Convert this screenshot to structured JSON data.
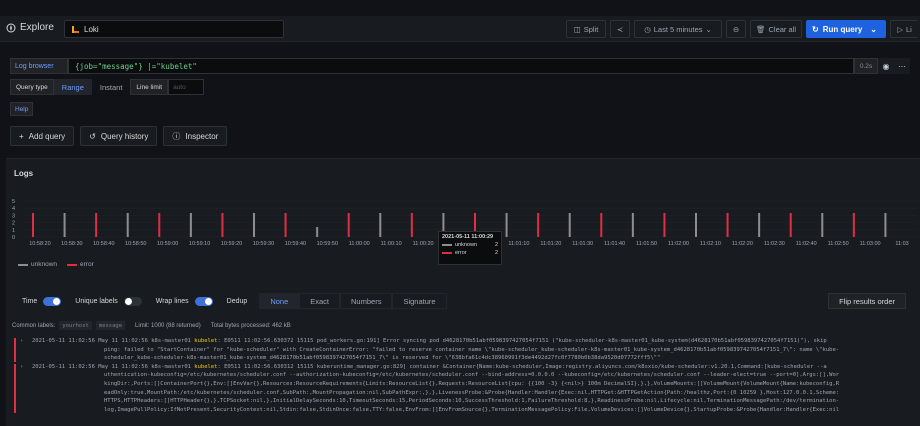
{
  "colors": {
    "unknown": "#8e8e8e",
    "error": "#e02f44",
    "accent": "#1f62e0",
    "link": "#6e9fff"
  },
  "header": {
    "title": "Explore",
    "datasource": "Loki",
    "split": "Split",
    "time_range": "Last 5 minutes",
    "clear_all": "Clear all",
    "run_query": "Run query",
    "live": "Li"
  },
  "query": {
    "log_browser": "Log browser",
    "expr": "{job=\"message\"} |=\"kubelet\"",
    "size": "0.2s",
    "query_type_label": "Query type",
    "range": "Range",
    "instant": "Instant",
    "line_limit_label": "Line limit",
    "line_limit_placeholder": "auto",
    "help": "Help"
  },
  "actions": {
    "add_query": "Add query",
    "query_history": "Query history",
    "inspector": "Inspector"
  },
  "logs": {
    "title": "Logs",
    "legend": {
      "unknown": "unknown",
      "error": "error"
    },
    "ticks": [
      "10:58:20",
      "10:58:30",
      "10:58:40",
      "10:58:50",
      "10:59:00",
      "10:59:10",
      "10:59:20",
      "10:59:30",
      "10:59:40",
      "10:59:50",
      "11:00:00",
      "11:00:10",
      "11:00:20",
      "11:00",
      "11:01:00",
      "11:01:10",
      "11:01:20",
      "11:01:30",
      "11:01:40",
      "11:01:50",
      "11:02:00",
      "11:02:10",
      "11:02:20",
      "11:02:30",
      "11:02:40",
      "11:02:50",
      "11:03:00",
      "11:03"
    ],
    "y_ticks": [
      "5",
      "4",
      "3",
      "2",
      "1",
      "0"
    ],
    "tooltip": {
      "time": "2021-05-11 11:00:29",
      "rows": [
        {
          "name": "unknown",
          "value": "2"
        },
        {
          "name": "error",
          "value": "2"
        }
      ]
    },
    "controls": {
      "time": "Time",
      "unique_labels": "Unique labels",
      "wrap_lines": "Wrap lines",
      "dedup": "Dedup",
      "dedup_options": [
        "None",
        "Exact",
        "Numbers",
        "Signature"
      ],
      "flip": "Flip results order"
    },
    "common_labels_label": "Common labels:",
    "common_labels": [
      "yourhost",
      "message"
    ],
    "limit": "Limit: 1000 (88 returned)",
    "bytes": "Total bytes processed: 462 kB",
    "entries": [
      {
        "ts": "2021-05-11 11:02:56",
        "lines": [
          {
            "pre": "May 11 11:02:56 k8s-master01 ",
            "hl": "kubelet",
            "post": ": E0511 11:02:56.630372   15115 pod_workers.go:191] Error syncing pod d4628170b51abf0598397427054f7151 (\"kube-scheduler-k8s-master01_kube-system(d4628170b51abf0598397427054f7151)\"), skip"
          },
          {
            "pre": "ping: failed to \"StartContainer\" for \"kube-scheduler\" with CreateContainerError: \"failed to reserve container name \\\"kube-scheduler_kube-scheduler-k8s-master01_kube-system_d4628170b51abf0598397427054f7151_7\\\": name \\\"kube-",
            "hl": "",
            "post": ""
          },
          {
            "pre": "scheduler_kube-scheduler-k8s-master01_kube-system_d4628170b51abf0598397427054f7151_7\\\" is reserved for \\\"638bfa61c4dc38960991f3de4492d27fc0f7780b0b38da9520d07772fff5\\\"\"",
            "hl": "",
            "post": ""
          }
        ]
      },
      {
        "ts": "2021-05-11 11:02:56",
        "lines": [
          {
            "pre": "May 11 11:02:56 k8s-master01 ",
            "hl": "kubelet",
            "post": ": E0511 11:02:56.630312   15115 kuberuntime_manager.go:829] container &Container{Name:kube-scheduler,Image:registry.aliyuncs.com/k8sxio/kube-scheduler:v1.20.1,Command:[kube-scheduler --a"
          },
          {
            "pre": "uthentication-kubeconfig=/etc/kubernetes/scheduler.conf --authorization-kubeconfig=/etc/kubernetes/scheduler.conf --bind-address=0.0.0.0 --kubeconfig=/etc/kubernetes/scheduler.conf --leader-elect=true --port=0],Args:[],Wor",
            "hl": "",
            "post": ""
          },
          {
            "pre": "kingDir:,Ports:[]ContainerPort{},Env:[]EnvVar{},Resources:ResourceRequirements{Limits:ResourceList{},Requests:ResourceList{cpu: {{100 -3} {<nil>} 100m DecimalSI},},},VolumeMounts:[]VolumeMount{VolumeMount{Name:kubeconfig,R",
            "hl": "",
            "post": ""
          },
          {
            "pre": "eadOnly:true,MountPath:/etc/kubernetes/scheduler.conf,SubPath:,MountPropagation:nil,SubPathExpr:,},},LivenessProbe:&Probe{Handler:Handler{Exec:nil,HTTPGet:&HTTPGetAction{Path:/healthz,Port:{0 10259 },Host:127.0.0.1,Scheme:",
            "hl": "",
            "post": ""
          },
          {
            "pre": "HTTPS,HTTPHeaders:[]HTTPHeader{},},TCPSocket:nil,},InitialDelaySeconds:10,TimeoutSeconds:15,PeriodSeconds:10,SuccessThreshold:1,FailureThreshold:8,},ReadinessProbe:nil,Lifecycle:nil,TerminationMessagePath:/dev/termination-",
            "hl": "",
            "post": ""
          },
          {
            "pre": "log,ImagePullPolicy:IfNotPresent,SecurityContext:nil,Stdin:false,StdinOnce:false,TTY:false,EnvFrom:[]EnvFromSource{},TerminationMessagePolicy:File,VolumeDevices:[]VolumeDevice{},StartupProbe:&Probe{Handler:Handler{Exec:nil",
            "hl": "",
            "post": ""
          }
        ]
      }
    ]
  }
}
